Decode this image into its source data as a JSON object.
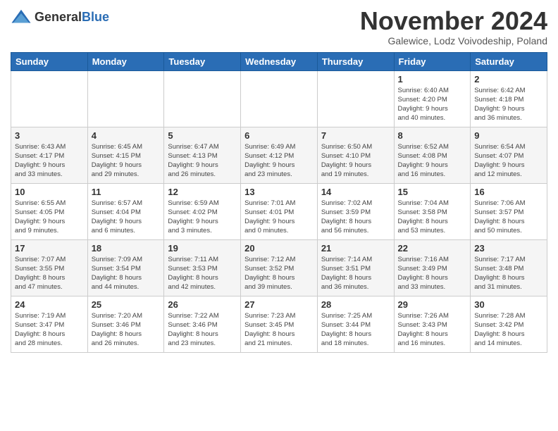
{
  "header": {
    "logo_general": "General",
    "logo_blue": "Blue",
    "month_title": "November 2024",
    "location": "Galewice, Lodz Voivodeship, Poland"
  },
  "columns": [
    "Sunday",
    "Monday",
    "Tuesday",
    "Wednesday",
    "Thursday",
    "Friday",
    "Saturday"
  ],
  "weeks": [
    [
      {
        "day": "",
        "info": ""
      },
      {
        "day": "",
        "info": ""
      },
      {
        "day": "",
        "info": ""
      },
      {
        "day": "",
        "info": ""
      },
      {
        "day": "",
        "info": ""
      },
      {
        "day": "1",
        "info": "Sunrise: 6:40 AM\nSunset: 4:20 PM\nDaylight: 9 hours\nand 40 minutes."
      },
      {
        "day": "2",
        "info": "Sunrise: 6:42 AM\nSunset: 4:18 PM\nDaylight: 9 hours\nand 36 minutes."
      }
    ],
    [
      {
        "day": "3",
        "info": "Sunrise: 6:43 AM\nSunset: 4:17 PM\nDaylight: 9 hours\nand 33 minutes."
      },
      {
        "day": "4",
        "info": "Sunrise: 6:45 AM\nSunset: 4:15 PM\nDaylight: 9 hours\nand 29 minutes."
      },
      {
        "day": "5",
        "info": "Sunrise: 6:47 AM\nSunset: 4:13 PM\nDaylight: 9 hours\nand 26 minutes."
      },
      {
        "day": "6",
        "info": "Sunrise: 6:49 AM\nSunset: 4:12 PM\nDaylight: 9 hours\nand 23 minutes."
      },
      {
        "day": "7",
        "info": "Sunrise: 6:50 AM\nSunset: 4:10 PM\nDaylight: 9 hours\nand 19 minutes."
      },
      {
        "day": "8",
        "info": "Sunrise: 6:52 AM\nSunset: 4:08 PM\nDaylight: 9 hours\nand 16 minutes."
      },
      {
        "day": "9",
        "info": "Sunrise: 6:54 AM\nSunset: 4:07 PM\nDaylight: 9 hours\nand 12 minutes."
      }
    ],
    [
      {
        "day": "10",
        "info": "Sunrise: 6:55 AM\nSunset: 4:05 PM\nDaylight: 9 hours\nand 9 minutes."
      },
      {
        "day": "11",
        "info": "Sunrise: 6:57 AM\nSunset: 4:04 PM\nDaylight: 9 hours\nand 6 minutes."
      },
      {
        "day": "12",
        "info": "Sunrise: 6:59 AM\nSunset: 4:02 PM\nDaylight: 9 hours\nand 3 minutes."
      },
      {
        "day": "13",
        "info": "Sunrise: 7:01 AM\nSunset: 4:01 PM\nDaylight: 9 hours\nand 0 minutes."
      },
      {
        "day": "14",
        "info": "Sunrise: 7:02 AM\nSunset: 3:59 PM\nDaylight: 8 hours\nand 56 minutes."
      },
      {
        "day": "15",
        "info": "Sunrise: 7:04 AM\nSunset: 3:58 PM\nDaylight: 8 hours\nand 53 minutes."
      },
      {
        "day": "16",
        "info": "Sunrise: 7:06 AM\nSunset: 3:57 PM\nDaylight: 8 hours\nand 50 minutes."
      }
    ],
    [
      {
        "day": "17",
        "info": "Sunrise: 7:07 AM\nSunset: 3:55 PM\nDaylight: 8 hours\nand 47 minutes."
      },
      {
        "day": "18",
        "info": "Sunrise: 7:09 AM\nSunset: 3:54 PM\nDaylight: 8 hours\nand 44 minutes."
      },
      {
        "day": "19",
        "info": "Sunrise: 7:11 AM\nSunset: 3:53 PM\nDaylight: 8 hours\nand 42 minutes."
      },
      {
        "day": "20",
        "info": "Sunrise: 7:12 AM\nSunset: 3:52 PM\nDaylight: 8 hours\nand 39 minutes."
      },
      {
        "day": "21",
        "info": "Sunrise: 7:14 AM\nSunset: 3:51 PM\nDaylight: 8 hours\nand 36 minutes."
      },
      {
        "day": "22",
        "info": "Sunrise: 7:16 AM\nSunset: 3:49 PM\nDaylight: 8 hours\nand 33 minutes."
      },
      {
        "day": "23",
        "info": "Sunrise: 7:17 AM\nSunset: 3:48 PM\nDaylight: 8 hours\nand 31 minutes."
      }
    ],
    [
      {
        "day": "24",
        "info": "Sunrise: 7:19 AM\nSunset: 3:47 PM\nDaylight: 8 hours\nand 28 minutes."
      },
      {
        "day": "25",
        "info": "Sunrise: 7:20 AM\nSunset: 3:46 PM\nDaylight: 8 hours\nand 26 minutes."
      },
      {
        "day": "26",
        "info": "Sunrise: 7:22 AM\nSunset: 3:46 PM\nDaylight: 8 hours\nand 23 minutes."
      },
      {
        "day": "27",
        "info": "Sunrise: 7:23 AM\nSunset: 3:45 PM\nDaylight: 8 hours\nand 21 minutes."
      },
      {
        "day": "28",
        "info": "Sunrise: 7:25 AM\nSunset: 3:44 PM\nDaylight: 8 hours\nand 18 minutes."
      },
      {
        "day": "29",
        "info": "Sunrise: 7:26 AM\nSunset: 3:43 PM\nDaylight: 8 hours\nand 16 minutes."
      },
      {
        "day": "30",
        "info": "Sunrise: 7:28 AM\nSunset: 3:42 PM\nDaylight: 8 hours\nand 14 minutes."
      }
    ]
  ]
}
